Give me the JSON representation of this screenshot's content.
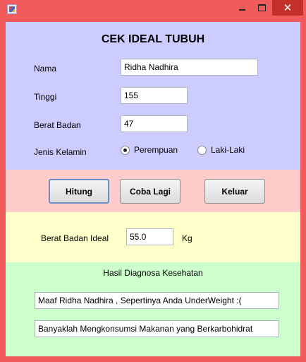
{
  "form": {
    "title": "CEK IDEAL TUBUH",
    "nama_label": "Nama",
    "nama_value": "Ridha Nadhira",
    "tinggi_label": "Tinggi",
    "tinggi_value": "155",
    "berat_label": "Berat Badan",
    "berat_value": "47",
    "jenis_label": "Jenis Kelamin",
    "radio_perempuan": "Perempuan",
    "radio_laki": "Laki-Laki",
    "selected_gender": "Perempuan"
  },
  "buttons": {
    "hitung": "Hitung",
    "coba_lagi": "Coba Lagi",
    "keluar": "Keluar"
  },
  "result": {
    "ideal_label": "Berat Badan Ideal",
    "ideal_value": "55.0",
    "unit": "Kg"
  },
  "diagnosis": {
    "heading": "Hasil Diagnosa Kesehatan",
    "line1": "Maaf Ridha Nadhira , Sepertinya Anda UnderWeight :(",
    "line2": "Banyaklah Mengkonsumsi Makanan yang Berkarbohidrat"
  },
  "colors": {
    "window_frame": "#f25b5b",
    "close_button": "#c4312b",
    "panel_form": "#ccccff",
    "panel_buttons": "#ffcccc",
    "panel_ideal": "#ffffcc",
    "panel_diagnosis": "#ccffcc"
  }
}
